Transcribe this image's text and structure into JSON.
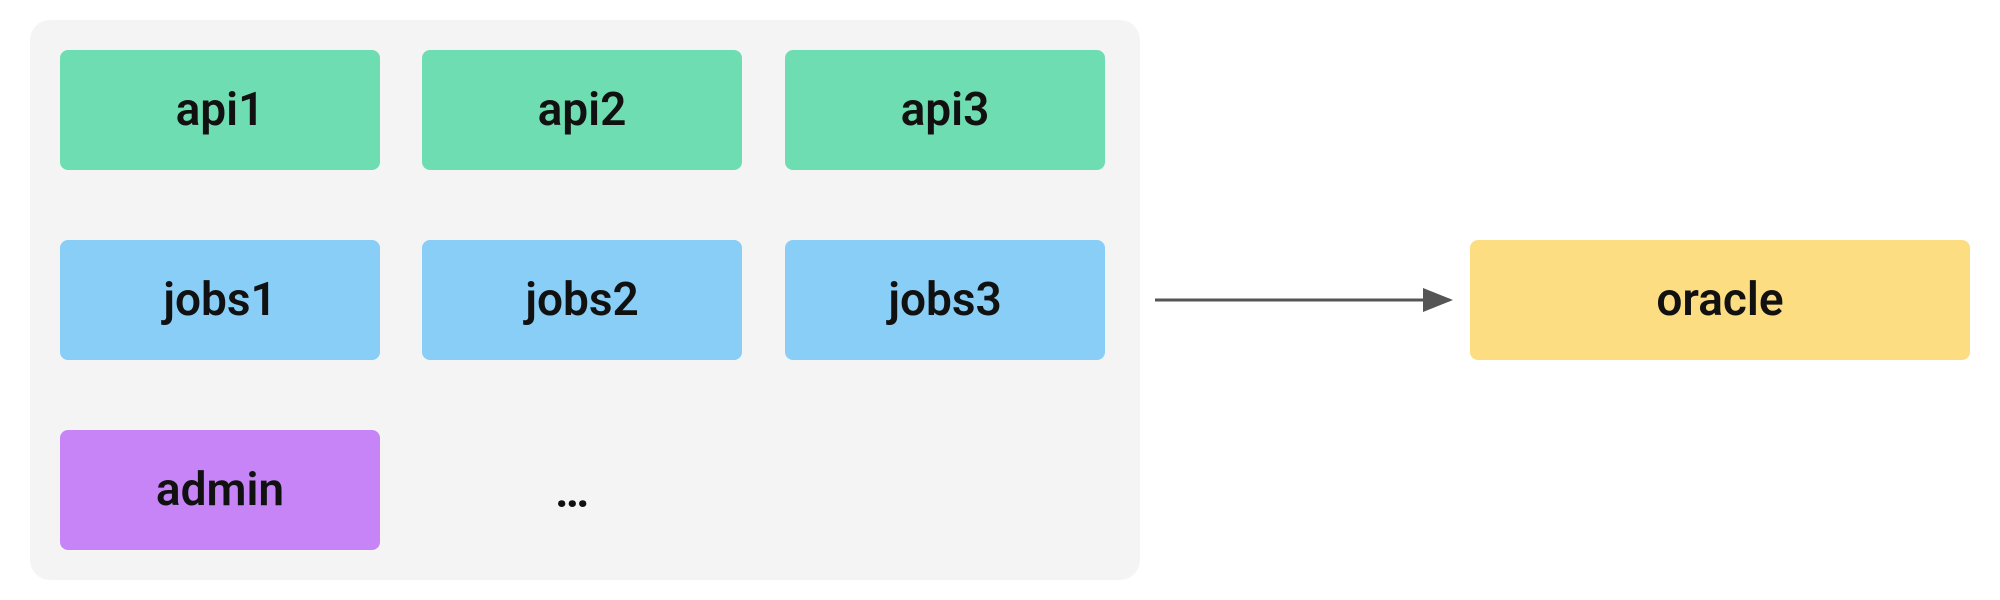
{
  "group": {
    "rows": [
      {
        "type": "api",
        "items": [
          "api1",
          "api2",
          "api3"
        ]
      },
      {
        "type": "jobs",
        "items": [
          "jobs1",
          "jobs2",
          "jobs3"
        ]
      },
      {
        "type": "admin",
        "items": [
          "admin"
        ]
      }
    ],
    "ellipsis": "…"
  },
  "target": {
    "label": "oracle"
  },
  "colors": {
    "api": "#6EDEB2",
    "jobs": "#88CEF6",
    "admin": "#C684F6",
    "oracle": "#FDDD82",
    "group_bg": "#F4F4F4",
    "arrow": "#555555"
  }
}
